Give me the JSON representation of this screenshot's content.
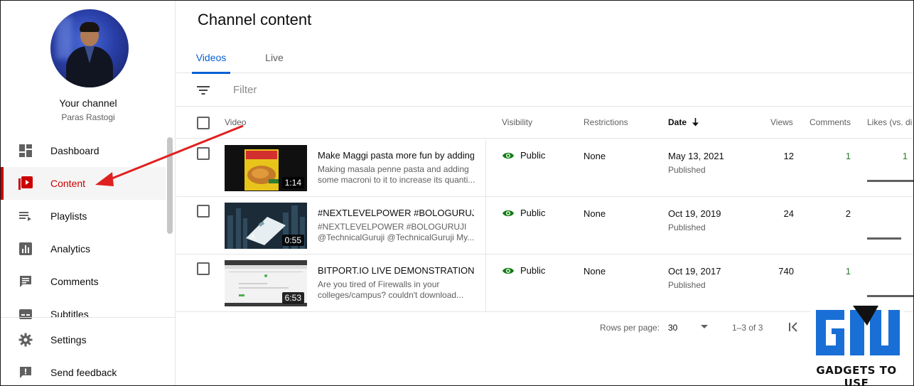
{
  "sidebar": {
    "channel_title": "Your channel",
    "channel_name": "Paras Rastogi",
    "items": [
      {
        "label": "Dashboard",
        "icon": "dashboard-icon"
      },
      {
        "label": "Content",
        "icon": "content-icon",
        "active": true
      },
      {
        "label": "Playlists",
        "icon": "playlists-icon"
      },
      {
        "label": "Analytics",
        "icon": "analytics-icon"
      },
      {
        "label": "Comments",
        "icon": "comments-icon"
      },
      {
        "label": "Subtitles",
        "icon": "subtitles-icon"
      }
    ],
    "bottom_items": [
      {
        "label": "Settings",
        "icon": "gear-icon"
      },
      {
        "label": "Send feedback",
        "icon": "feedback-icon"
      }
    ]
  },
  "main": {
    "title": "Channel content",
    "tabs": [
      {
        "label": "Videos",
        "active": true
      },
      {
        "label": "Live"
      }
    ],
    "filter_placeholder": "Filter",
    "columns": {
      "video": "Video",
      "visibility": "Visibility",
      "restrictions": "Restrictions",
      "date": "Date",
      "views": "Views",
      "comments": "Comments",
      "likes": "Likes (vs. di"
    },
    "rows": [
      {
        "title": "Make Maggi pasta more fun by adding ...",
        "description": "Making masala penne pasta and adding some macroni to it to increase its quanti...",
        "duration": "1:14",
        "visibility": "Public",
        "restrictions": "None",
        "date": "May 13, 2021",
        "status": "Published",
        "views": "12",
        "comments": "1",
        "likes": "1"
      },
      {
        "title": "#NEXTLEVELPOWER #BOLOGURUJI ...",
        "description": "#NEXTLEVELPOWER #BOLOGURUJI @TechnicalGuruji @TechnicalGuruji My...",
        "duration": "0:55",
        "visibility": "Public",
        "restrictions": "None",
        "date": "Oct 19, 2019",
        "status": "Published",
        "views": "24",
        "comments": "2",
        "likes": ""
      },
      {
        "title": "BITPORT.IO LIVE DEMONSTRATION [h...",
        "description": "Are you tired of Firewalls in your colleges/campus? couldn't download...",
        "duration": "6:53",
        "visibility": "Public",
        "restrictions": "None",
        "date": "Oct 19, 2017",
        "status": "Published",
        "views": "740",
        "comments": "1",
        "likes": ""
      }
    ],
    "pagination": {
      "rows_per_page_label": "Rows per page:",
      "rows_per_page": "30",
      "range": "1–3 of 3"
    }
  },
  "watermark": {
    "text": "GADGETS TO USE"
  },
  "colors": {
    "accent_red": "#cc0000",
    "tab_blue": "#065fd4",
    "public_green": "#0f7b0f",
    "comment_green": "#2b7d2b"
  }
}
